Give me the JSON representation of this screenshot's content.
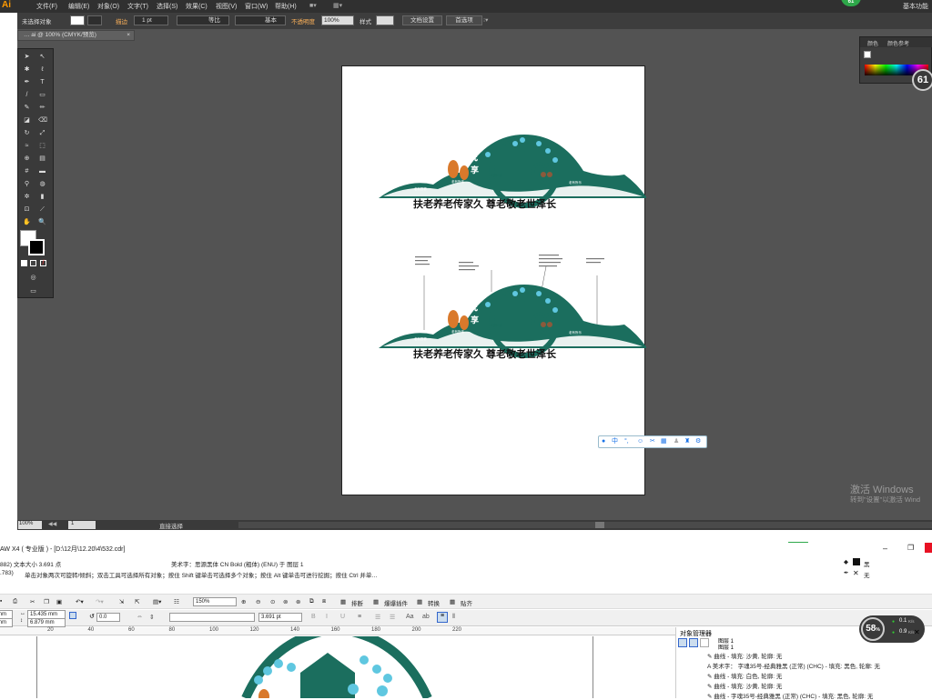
{
  "illustrator": {
    "logo": "Ai",
    "menu": [
      "文件(F)",
      "编辑(E)",
      "对象(O)",
      "文字(T)",
      "选择(S)",
      "效果(C)",
      "视图(V)",
      "窗口(W)",
      "帮助(H)"
    ],
    "workspace": "基本功能",
    "control": {
      "selection": "未选择对象",
      "stroke_label": "描边",
      "stroke_weight": "1 pt",
      "stroke_style": "等比",
      "brush_style": "基本",
      "opacity_label": "不透明度",
      "opacity_value": "100%",
      "style_label": "样式",
      "doc_setup": "文档设置",
      "preferences": "首选项"
    },
    "doc_tab": "… ai @ 100% (CMYK/预览)",
    "zoom": "100%",
    "page": "1",
    "status_tool": "直接选择",
    "color_panel": {
      "tab1": "颜色",
      "tab2": "颜色参考"
    },
    "perf_badge": "61"
  },
  "artwork": {
    "slogan": "扶老养老传家久  尊老敬老世泽长",
    "center_char_1": "悦",
    "center_char_2": "享",
    "tag_left": "老有所养",
    "tag_mid": "老有所依",
    "tag_right": "老有所乐",
    "right_sub": "幸福乐满"
  },
  "ime_toolbar": {
    "label": "中"
  },
  "activation": {
    "title": "激活 Windows",
    "subtitle": "转到\"设置\"以激活 Wind"
  },
  "coreldraw": {
    "title": "AW X4 ( 专业版 ) - [D:\\12月\\12.20\\4\\532.cdr]",
    "status1_left": "882) 文本大小 3.691 点",
    "status1_mid": "美术字：思源黑体 CN Bold (粗体) (ENU) 于 图层 1",
    "status2_left": ".783)",
    "status2_mid": "单击对象两次可旋转/倾斜；双击工具可选择所有对象；按住 Shift 键单击可选择多个对象；按住 Alt 键单击可进行挖掘；按住 Ctrl 并单…",
    "fill_label": "黑",
    "outline_label": "无",
    "zoom": "150%",
    "toolbar": {
      "layout": "排断",
      "plugin": "爆爆插件",
      "convert": "转换",
      "paste": "贴齐"
    },
    "width": "15.435 mm",
    "height": "6.879 mm",
    "x_suffix": "mm",
    "angle": "0.0",
    "font_size": "3.691 pt",
    "ruler_ticks": [
      "20",
      "40",
      "60",
      "80",
      "100",
      "120",
      "140",
      "160",
      "180",
      "200",
      "220"
    ],
    "perf_badge_top": "58",
    "perf_badge": "58",
    "perf_sub": "%",
    "net_up": "0.1",
    "net_up_unit": "K/s",
    "net_down": "0.9",
    "net_down_unit": "K/s",
    "object_manager": {
      "title": "对象管理器",
      "layer": "图层 1",
      "rows": [
        "曲线 - 填充: 沙黄, 轮廓: 无",
        "美术字： 字魂35号-经典雅黑 (正常) (CHC) - 填充: 黑色, 轮廓: 无",
        "曲线 - 填充: 白色, 轮廓: 无",
        "曲线 - 填充: 沙黄, 轮廓: 无",
        "曲线 - 字魂35号-经典雅黑 (正常) (CHC) - 填充: 黑色, 轮廓: 无"
      ]
    }
  },
  "colors": {
    "teal": "#1b6e5e",
    "orange": "#d9792b",
    "brown": "#8a5a3c",
    "light_blue": "#5fc7e0"
  }
}
